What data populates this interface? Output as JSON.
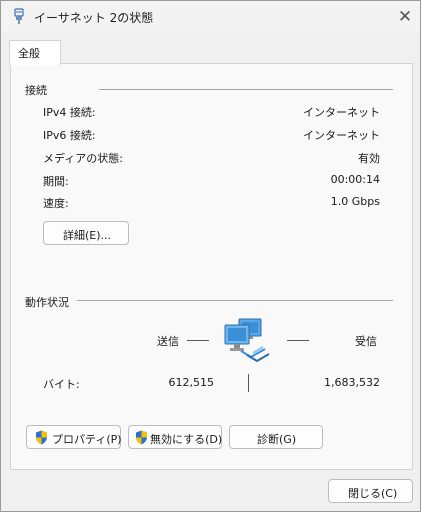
{
  "window": {
    "title": "イーサネット 2の状態",
    "close_glyph": "✕"
  },
  "tabs": [
    {
      "label": "全般"
    }
  ],
  "connection": {
    "title": "接続",
    "rows": [
      {
        "label": "IPv4 接続:",
        "value": "インターネット"
      },
      {
        "label": "IPv6 接続:",
        "value": "インターネット"
      },
      {
        "label": "メディアの状態:",
        "value": "有効"
      },
      {
        "label": "期間:",
        "value": "00:00:14"
      },
      {
        "label": "速度:",
        "value": "1.0 Gbps"
      }
    ],
    "details_button": "詳細(E)..."
  },
  "activity": {
    "title": "動作状況",
    "sent_label": "送信",
    "received_label": "受信",
    "bytes_label": "バイト:",
    "bytes_sent": "612,515",
    "bytes_received": "1,683,532",
    "icon": "network-computers-icon"
  },
  "buttons": {
    "properties": "プロパティ(P)",
    "disable": "無効にする(D)",
    "diagnose": "診断(G)",
    "close": "閉じる(C)"
  },
  "colors": {
    "shield_blue": "#2b6fd6",
    "shield_yellow": "#f2c200",
    "monitor_blue": "#3a8fd8"
  }
}
